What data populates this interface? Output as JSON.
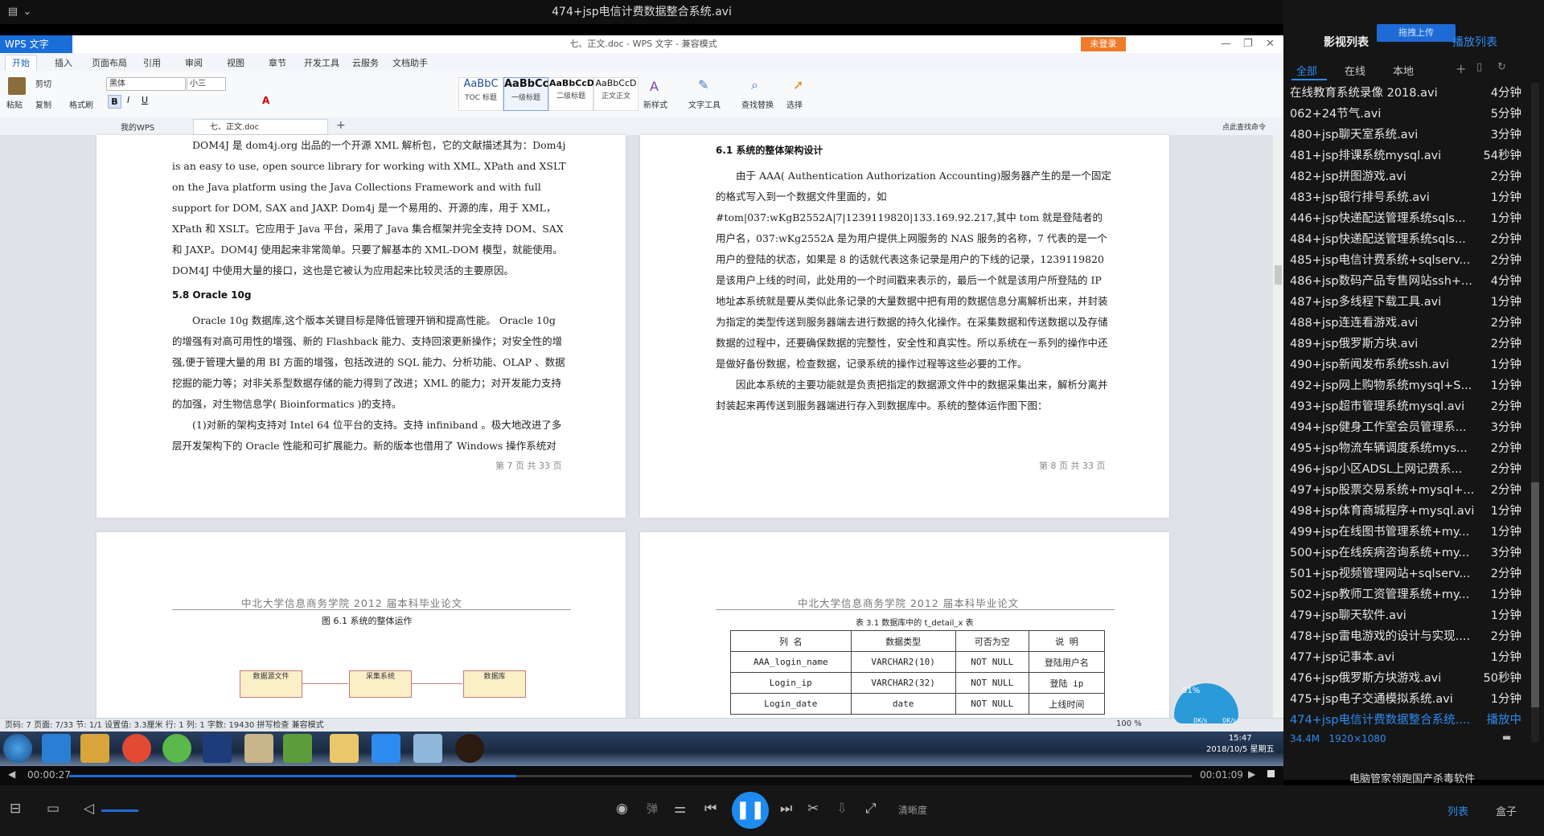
{
  "player": {
    "title": "474+jsp电信计费数据整合系统.avi",
    "current_time": "00:00:27",
    "total_time": "00:01:09",
    "progress": 0.398,
    "quality_label": "清晰度",
    "danmu_label": "弹",
    "list_button": "列表",
    "box_button": "盒子"
  },
  "sidebar": {
    "title": "影视列表",
    "upload_btn": "拖拽上传",
    "playlist_link": "播放列表",
    "tabs": [
      "全部",
      "在线",
      "本地"
    ],
    "items": [
      {
        "name": "在线教育系统录像 2018.avi",
        "duration": "4分钟"
      },
      {
        "name": "062+24节气.avi",
        "duration": "5分钟"
      },
      {
        "name": "480+jsp聊天室系统.avi",
        "duration": "3分钟"
      },
      {
        "name": "481+jsp排课系统mysql.avi",
        "duration": "54秒钟"
      },
      {
        "name": "482+jsp拼图游戏.avi",
        "duration": "2分钟"
      },
      {
        "name": "483+jsp银行排号系统.avi",
        "duration": "1分钟"
      },
      {
        "name": "446+jsp快递配送管理系统sqls...",
        "duration": "1分钟"
      },
      {
        "name": "484+jsp快递配送管理系统sqls...",
        "duration": "2分钟"
      },
      {
        "name": "485+jsp电信计费系统+sqlserv...",
        "duration": "2分钟"
      },
      {
        "name": "486+jsp数码产品专售网站ssh+...",
        "duration": "4分钟"
      },
      {
        "name": "487+jsp多线程下载工具.avi",
        "duration": "1分钟"
      },
      {
        "name": "488+jsp连连看游戏.avi",
        "duration": "2分钟"
      },
      {
        "name": "489+jsp俄罗斯方块.avi",
        "duration": "2分钟"
      },
      {
        "name": "490+jsp新闻发布系统ssh.avi",
        "duration": "1分钟"
      },
      {
        "name": "492+jsp网上购物系统mysql+S...",
        "duration": "1分钟"
      },
      {
        "name": "493+jsp超市管理系统mysql.avi",
        "duration": "2分钟"
      },
      {
        "name": "494+jsp健身工作室会员管理系...",
        "duration": "3分钟"
      },
      {
        "name": "495+jsp物流车辆调度系统mys...",
        "duration": "2分钟"
      },
      {
        "name": "496+jsp小区ADSL上网记费系...",
        "duration": "2分钟"
      },
      {
        "name": "497+jsp股票交易系统+mysql+...",
        "duration": "2分钟"
      },
      {
        "name": "498+jsp体育商城程序+mysql.avi",
        "duration": "1分钟"
      },
      {
        "name": "499+jsp在线图书管理系统+my...",
        "duration": "1分钟"
      },
      {
        "name": "500+jsp在线疾病咨询系统+my...",
        "duration": "3分钟"
      },
      {
        "name": "501+jsp视频管理网站+sqlserv...",
        "duration": "2分钟"
      },
      {
        "name": "502+jsp教师工资管理系统+my...",
        "duration": "1分钟"
      },
      {
        "name": "479+jsp聊天软件.avi",
        "duration": "1分钟"
      },
      {
        "name": "478+jsp雷电游戏的设计与实现....",
        "duration": "2分钟"
      },
      {
        "name": "477+jsp记事本.avi",
        "duration": "1分钟"
      },
      {
        "name": "476+jsp俄罗斯方块游戏.avi",
        "duration": "50秒钟"
      },
      {
        "name": "475+jsp电子交通模拟系统.avi",
        "duration": "1分钟"
      },
      {
        "name": "474+jsp电信计费数据整合系统....",
        "duration": "播放中"
      }
    ],
    "active_size": "34.4M",
    "active_resolution": "1920×1080",
    "ad_text": "电脑管家领跑国产杀毒软件"
  },
  "wps": {
    "logo": "WPS 文字",
    "doc_title": "七、正文.doc - WPS 文字 - 兼容模式",
    "login": "未登录",
    "menus": [
      "开始",
      "插入",
      "页面布局",
      "引用",
      "审阅",
      "视图",
      "章节",
      "开发工具",
      "云服务",
      "文档助手"
    ],
    "font_name": "黑体",
    "font_size": "小三",
    "styles": [
      {
        "sample": "AaBbC",
        "label": "TOC 标题"
      },
      {
        "sample": "AaBbCc",
        "label": "一级标题"
      },
      {
        "sample": "AaBbCcD",
        "label": "二级标题"
      },
      {
        "sample": "AaBbCcD",
        "label": "正文正文"
      }
    ],
    "ribbon_labels": {
      "paste": "粘贴",
      "cut": "剪切",
      "copy": "复制",
      "format_painter": "格式刷",
      "new_style": "新样式",
      "text_tools": "文字工具",
      "find_replace": "查找替换",
      "select": "选择"
    },
    "tabs": {
      "mywps": "我的WPS",
      "doc": "七、正文.doc"
    },
    "search_cmd": "点此查找命令",
    "status": "页码: 7   页面: 7/33   节: 1/1   设置值: 3.3厘米   行: 1   列: 1   字数: 19430   拼写检查   兼容模式",
    "zoom": "100 %"
  },
  "page7": {
    "paragraph1": "DOM4J 是 dom4j.org 出品的一个开源 XML 解析包，它的文献描述其为：Dom4j is an easy to use, open source library for working with XML, XPath and XSLT on the Java platform using the Java Collections Framework and with full support for DOM, SAX and JAXP. Dom4j 是一个易用的、开源的库，用于 XML，XPath 和 XSLT。它应用于 Java 平台，采用了 Java 集合框架并完全支持 DOM、SAX和 JAXP。DOM4J 使用起来非常简单。只要了解基本的 XML-DOM 模型，就能使用。DOM4J 中使用大量的接口，这也是它被认为应用起来比较灵活的主要原因。",
    "heading": "5.8 Oracle 10g",
    "paragraph2": "Oracle 10g 数据库,这个版本关键目标是降低管理开销和提高性能。 Oracle 10g 的增强有对高可用性的增强、新的 Flashback 能力、支持回滚更新操作；对安全性的增强,便于管理大量的用 BI 方面的增强，包括改进的 SQL 能力、分析功能、OLAP 、数据挖掘的能力等；对非关系型数据存储的能力得到了改进；XML 的能力；对开发能力支持的加强，对生物信息学( Bioinformatics )的支持。",
    "paragraph3": "(1)对新的架构支持对 Intel 64 位平台的支持。支持 infiniband 。极大地改进了多层开发架构下的 Oracle 性能和可扩展能力。新的版本也借用了 Windows 操作系统对",
    "footer": "第 7 页  共 33 页"
  },
  "page8": {
    "heading": "6.1 系统的整体架构设计",
    "paragraph1": "由于 AAA( Authentication Authorization Accounting)服务器产生的是一个固定的格式写入到一个数据文件里面的，如#tom|037:wKgB2552A|7|1239119820|133.169.92.217,其中 tom 就是登陆者的用户名，037:wKg2552A 是为用户提供上网服务的 NAS 服务的名称，7 代表的是一个用户的登陆的状态，如果是 8 的话就代表这条记录是用户的下线的记录，1239119820 是该用户上线的时间，此处用的一个时间戳来表示的，最后一个就是该用户所登陆的 IP 地址。",
    "paragraph2": "本系统就是要从类似此条记录的大量数据中把有用的数据信息分离解析出来，并封装为指定的类型传送到服务器端去进行数据的持久化操作。在采集数据和传送数据以及存储数据的过程中，还要确保数据的完整性，安全性和真实性。所以系统在一系列的操作中还是做好备份数据，检查数据，记录系统的操作过程等这些必要的工作。",
    "paragraph3": "因此本系统的主要功能就是负责把指定的数据源文件中的数据采集出来，解析分离并封装起来再传送到服务器端进行存入到数据库中。系统的整体运作图下图：",
    "footer": "第 8 页  共 33 页"
  },
  "page9": {
    "header": "中北大学信息商务学院 2012 届本科毕业论文",
    "figure_title": "图 6.1 系统的整体运作",
    "boxes": [
      "数据源文件",
      "采集系统",
      "数据库"
    ]
  },
  "page10": {
    "header": "中北大学信息商务学院 2012 届本科毕业论文",
    "table_title": "表 3.1  数据库中的 t_detail_x 表",
    "table_header": [
      "列 名",
      "数据类型",
      "可否为空",
      "说 明"
    ],
    "table_rows": [
      [
        "AAA_login_name",
        "VARCHAR2(10)",
        "NOT NULL",
        "登陆用户名"
      ],
      [
        "Login_ip",
        "VARCHAR2(32)",
        "NOT NULL",
        "登陆 ip"
      ],
      [
        "Login_date",
        "date",
        "NOT NULL",
        "上线时间"
      ]
    ]
  },
  "taskbar": {
    "time": "15:47",
    "date": "2018/10/5 星期五",
    "net_up": "0K/s",
    "net_down": "0K/s",
    "battery": "51%"
  }
}
